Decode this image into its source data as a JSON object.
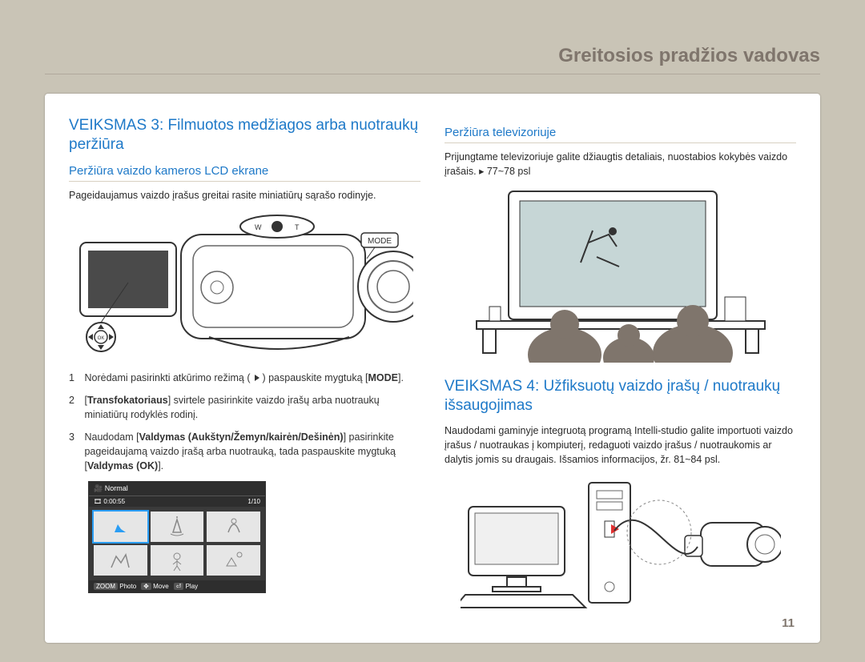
{
  "page_header": "Greitosios pradžios vadovas",
  "page_number": "11",
  "left": {
    "step_heading": "VEIKSMAS 3: Filmuotos medžiagos arba nuotraukų peržiūra",
    "sub1": "Peržiūra vaizdo kameros LCD ekrane",
    "sub1_body": "Pageidaujamus vaizdo įrašus greitai rasite miniatiūrų sąrašo rodinyje.",
    "item1_num": "1",
    "item1_pre": "Norėdami pasirinkti atkūrimo režimą (",
    "item1_post": ") paspauskite mygtuką [",
    "item1_bold": "MODE",
    "item1_end": "].",
    "item2_num": "2",
    "item2_pre": "[",
    "item2_bold": "Transfokatoriaus",
    "item2_post": "] svirtele pasirinkite vaizdo įrašų arba nuotraukų miniatiūrų rodyklės rodinį.",
    "item3_num": "3",
    "item3_pre": "Naudodam [",
    "item3_bold1": "Valdymas (Aukštyn/Žemyn/kairėn/Dešinėn)",
    "item3_mid": "] pasirinkite pageidaujamą vaizdo įrašą arba nuotrauką, tada paspauskite mygtuką [",
    "item3_bold2": "Valdymas (OK)",
    "item3_end": "].",
    "mode_label": "MODE",
    "ok_label": "OK",
    "thumb": {
      "top_left": "Normal",
      "time": "0:00:55",
      "count": "1/10",
      "bottom": {
        "zoom": "ZOOM",
        "zoom_label": "Photo",
        "move": "Move",
        "play": "Play"
      }
    }
  },
  "right": {
    "sub1": "Peržiūra televizoriuje",
    "sub1_body": "Prijungtame televizoriuje galite džiaugtis detaliais, nuostabios kokybės vaizdo įrašais. ▸ 77~78 psl",
    "step_heading": "VEIKSMAS 4: Užfiksuotų vaizdo įrašų / nuotraukų išsaugojimas",
    "body": "Naudodami gaminyje integruotą programą Intelli-studio galite importuoti vaizdo įrašus / nuotraukas į kompiuterį, redaguoti vaizdo įrašus / nuotraukomis ar dalytis jomis su draugais. Išsamios informacijos, žr. 81~84 psl."
  }
}
